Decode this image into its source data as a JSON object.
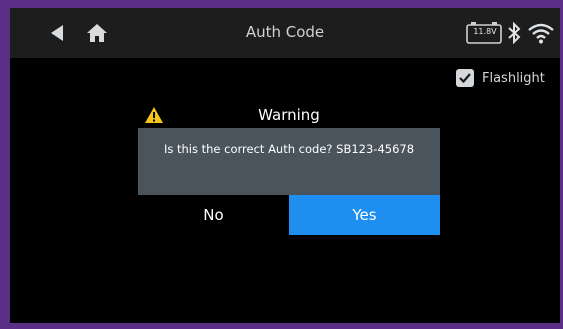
{
  "header": {
    "title": "Auth Code",
    "back_icon": "back-arrow-icon",
    "home_icon": "home-icon"
  },
  "status": {
    "battery_voltage": "11.8V",
    "bluetooth_icon": "bluetooth-icon",
    "wifi_icon": "wifi-icon"
  },
  "options": {
    "flashlight_label": "Flashlight",
    "flashlight_checked": true
  },
  "dialog": {
    "title": "Warning",
    "icon": "warning-icon",
    "message": "Is this the correct Auth code? SB123-45678",
    "no_label": "No",
    "yes_label": "Yes"
  },
  "colors": {
    "frame": "#5b2f86",
    "accent": "#1e8ff0",
    "dialog_body": "#4a545c",
    "warning": "#f5c518"
  }
}
